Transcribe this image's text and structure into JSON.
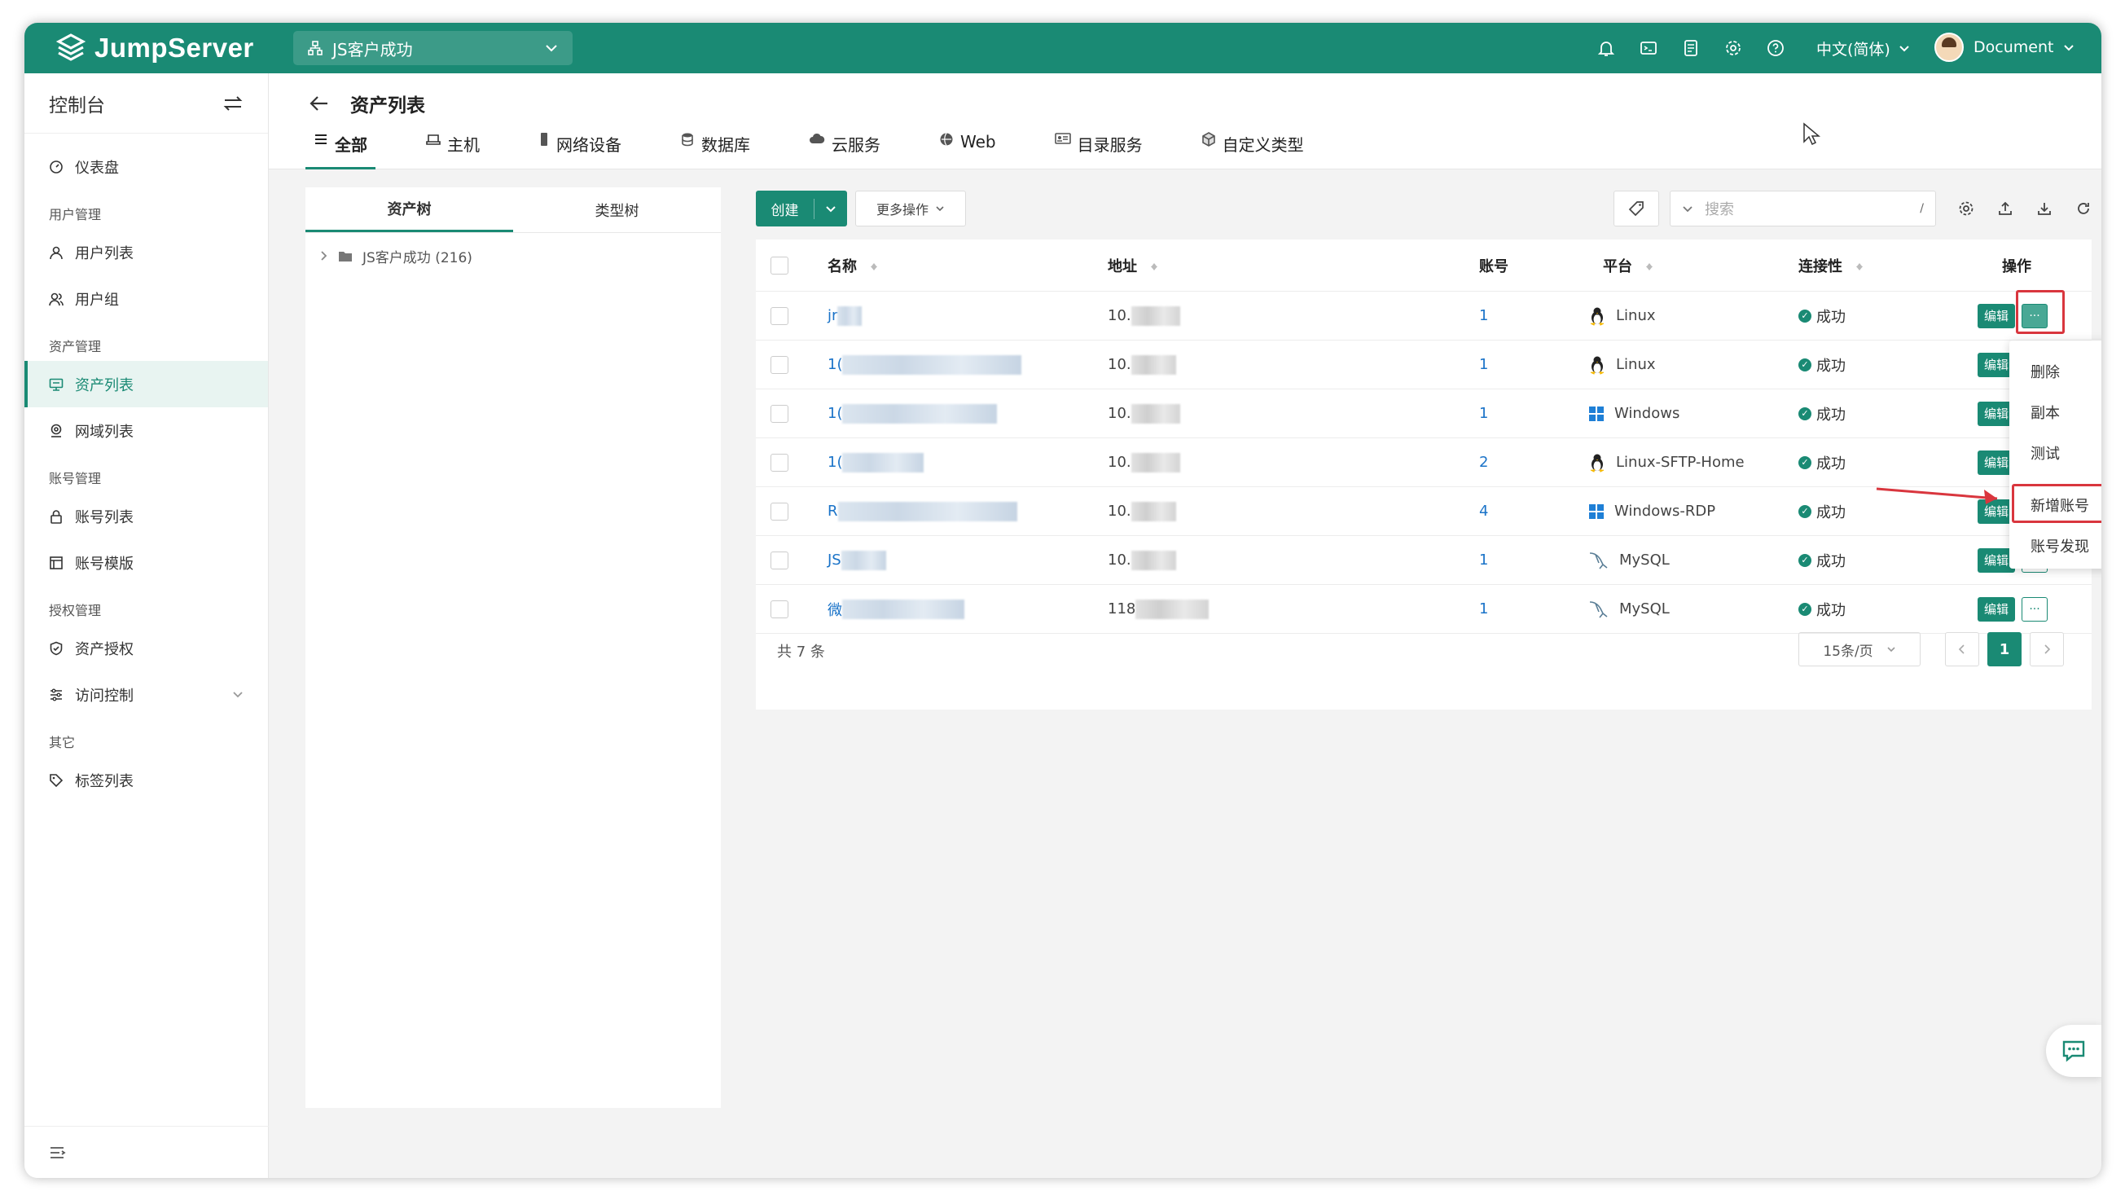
{
  "app": {
    "name": "JumpServer",
    "org": "JS客户成功",
    "lang": "中文(简体)",
    "user": "Document"
  },
  "sidebar": {
    "title": "控制台",
    "dashboard": "仪表盘",
    "sec_user": "用户管理",
    "user_list": "用户列表",
    "user_group": "用户组",
    "sec_asset": "资产管理",
    "asset_list": "资产列表",
    "zone_list": "网域列表",
    "sec_account": "账号管理",
    "account_list": "账号列表",
    "account_template": "账号模版",
    "sec_perm": "授权管理",
    "asset_perm": "资产授权",
    "access_control": "访问控制",
    "sec_other": "其它",
    "label_list": "标签列表"
  },
  "page": {
    "title": "资产列表"
  },
  "tabs": [
    "全部",
    "主机",
    "网络设备",
    "数据库",
    "云服务",
    "Web",
    "目录服务",
    "自定义类型"
  ],
  "tree": {
    "tab_asset": "资产树",
    "tab_type": "类型树",
    "root": "JS客户成功 (216)"
  },
  "toolbar": {
    "create": "创建",
    "more": "更多操作",
    "search_placeholder": "搜索",
    "search_key": "/"
  },
  "table": {
    "headers": {
      "name": "名称",
      "address": "地址",
      "accounts": "账号",
      "platform": "平台",
      "connectivity": "连接性",
      "actions": "操作"
    },
    "rows": [
      {
        "name": "jr",
        "address": "10.",
        "accounts": "1",
        "platform": "Linux",
        "status": "成功",
        "edit": "编辑"
      },
      {
        "name": "1(",
        "address": "10.",
        "accounts": "1",
        "platform": "Linux",
        "status": "成功",
        "edit": "编辑"
      },
      {
        "name": "1(",
        "address": "10.",
        "accounts": "1",
        "platform": "Windows",
        "status": "成功",
        "edit": "编辑"
      },
      {
        "name": "1(",
        "address": "10.",
        "accounts": "2",
        "platform": "Linux-SFTP-Home",
        "status": "成功",
        "edit": "编辑"
      },
      {
        "name": "R",
        "address": "10.",
        "accounts": "4",
        "platform": "Windows-RDP",
        "status": "成功",
        "edit": "编辑"
      },
      {
        "name": "JS",
        "address": "10.",
        "accounts": "1",
        "platform": "MySQL",
        "status": "成功",
        "edit": "编辑"
      },
      {
        "name": "微",
        "address": "118",
        "accounts": "1",
        "platform": "MySQL",
        "status": "成功",
        "edit": "编辑"
      }
    ],
    "total": "共 7 条",
    "page_size": "15条/页",
    "current_page": "1"
  },
  "menu": [
    "删除",
    "副本",
    "测试",
    "新增账号",
    "账号发现"
  ],
  "colors": {
    "primary": "#1a8a74",
    "link": "#1a73c8",
    "highlight": "#d9363e"
  }
}
